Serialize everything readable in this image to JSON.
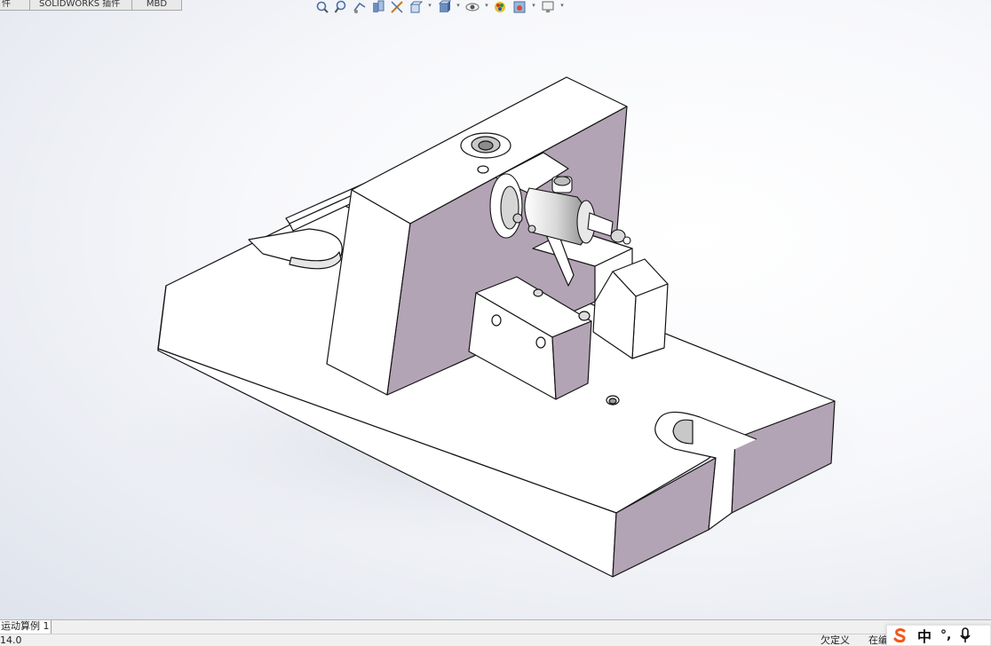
{
  "tabs": {
    "items": [
      "件",
      "SOLIDWORKS 插件",
      "MBD"
    ]
  },
  "hud": {
    "icons": [
      "zoom-to-fit-icon",
      "zoom-to-area-icon",
      "previous-view-icon",
      "section-view-icon",
      "dynamic-annotation-icon",
      "view-orientation-icon",
      "display-style-icon",
      "hide-show-items-icon",
      "edit-appearance-icon",
      "apply-scene-icon",
      "view-settings-icon"
    ]
  },
  "bottom_tabs": {
    "items": [
      "运动算例 1"
    ]
  },
  "status": {
    "left": "14.0",
    "underdefined": "欠定义",
    "editing": "在编"
  },
  "ime": {
    "lang": "中",
    "punct": "°,"
  },
  "colors": {
    "face_light": "#ffffff",
    "face_shadow": "#b3a4b5",
    "edge": "#141414",
    "ime_accent": "#f05a1a"
  }
}
